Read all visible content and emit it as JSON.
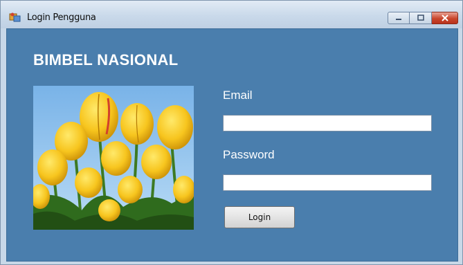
{
  "window": {
    "title": "Login Pengguna"
  },
  "form": {
    "brand": "BIMBEL NASIONAL",
    "email_label": "Email",
    "email_value": "",
    "password_label": "Password",
    "password_value": "",
    "login_label": "Login",
    "photo_subject": "yellow tulips"
  },
  "colors": {
    "form_background": "#4a7ead",
    "close_button": "#c9462c",
    "text": "#ffffff"
  },
  "icons": [
    "app-icon",
    "minimize-icon",
    "maximize-icon",
    "close-icon"
  ]
}
